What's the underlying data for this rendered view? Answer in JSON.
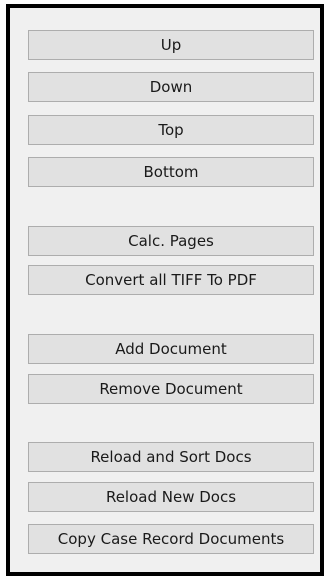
{
  "buttons": {
    "up": "Up",
    "down": "Down",
    "top": "Top",
    "bottom": "Bottom",
    "calc_pages": "Calc. Pages",
    "convert_tiff_to_pdf": "Convert all TIFF To PDF",
    "add_document": "Add Document",
    "remove_document": "Remove Document",
    "reload_and_sort_docs": "Reload and Sort Docs",
    "reload_new_docs": "Reload New Docs",
    "copy_case_record_documents": "Copy Case Record Documents"
  }
}
